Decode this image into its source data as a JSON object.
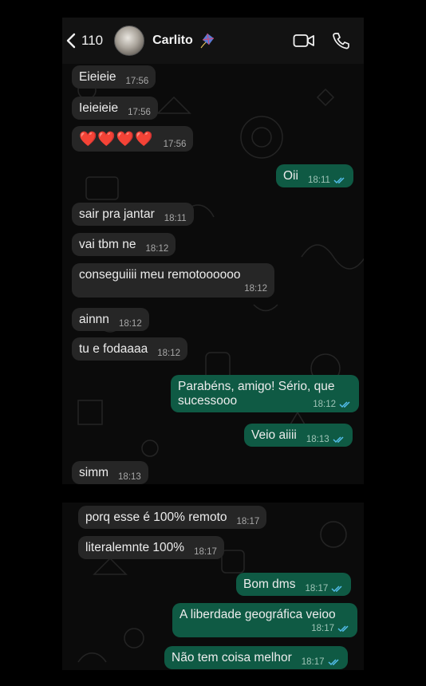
{
  "header": {
    "back_count": "110",
    "contact_name": "Carlito"
  },
  "colors": {
    "incoming_bubble": "#262626",
    "outgoing_bubble": "#0f5a44",
    "read_ticks": "#53bdeb",
    "background": "#0b0b0b"
  },
  "messages_part1": [
    {
      "text": "Eieieie",
      "time": "17:56",
      "dir": "in"
    },
    {
      "text": "Ieieieie",
      "time": "17:56",
      "dir": "in"
    },
    {
      "text": "❤️❤️❤️❤️",
      "time": "17:56",
      "dir": "in"
    },
    {
      "text": "Oii",
      "time": "18:11",
      "dir": "out",
      "read": true
    },
    {
      "text": "sair pra jantar",
      "time": "18:11",
      "dir": "in"
    },
    {
      "text": "vai tbm ne",
      "time": "18:12",
      "dir": "in"
    },
    {
      "text": "conseguiiii meu remotoooooo",
      "time": "18:12",
      "dir": "in"
    },
    {
      "text": "ainnn",
      "time": "18:12",
      "dir": "in"
    },
    {
      "text": "tu e fodaaaa",
      "time": "18:12",
      "dir": "in"
    },
    {
      "text_line1": "Parabéns, amigo! Sério, que",
      "text_line2": "sucessooo",
      "time": "18:12",
      "dir": "out",
      "read": true
    },
    {
      "text": "Veio aiiii",
      "time": "18:13",
      "dir": "out",
      "read": true
    },
    {
      "text": "simm",
      "time": "18:13",
      "dir": "in"
    }
  ],
  "messages_part2": [
    {
      "text": "porq esse é 100% remoto",
      "time": "18:17",
      "dir": "in"
    },
    {
      "text": "literalemnte 100%",
      "time": "18:17",
      "dir": "in"
    },
    {
      "text": "Bom dms",
      "time": "18:17",
      "dir": "out",
      "read": true
    },
    {
      "text": "A liberdade geográfica veioo",
      "time": "18:17",
      "dir": "out",
      "read": true
    },
    {
      "text": "Não tem coisa melhor",
      "time": "18:17",
      "dir": "out",
      "read": true
    }
  ]
}
